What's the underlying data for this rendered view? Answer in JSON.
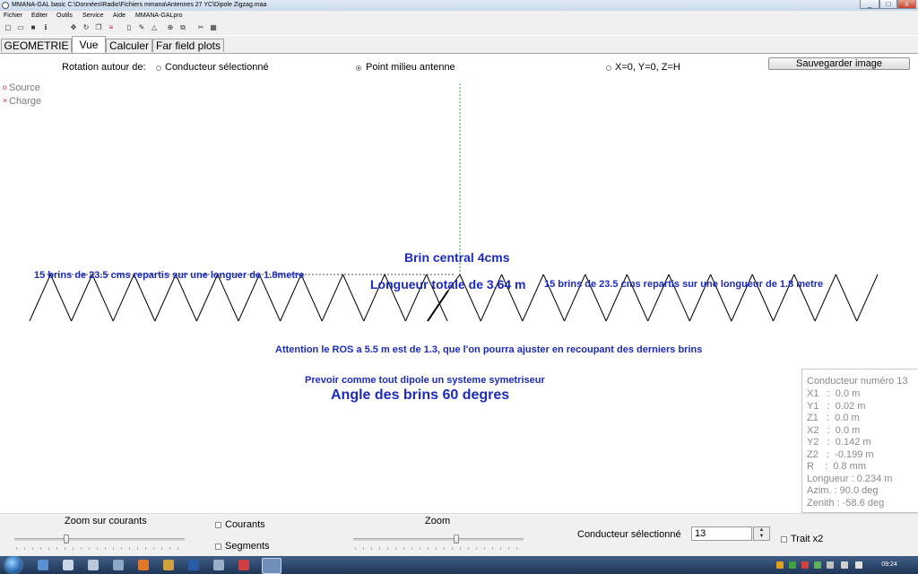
{
  "window": {
    "title": "MMANA-GAL basic C:\\Données\\Radio\\Fichiers mmana\\Antennes 27 YC\\Dipole Zigzag.maa",
    "minimize": "_",
    "maximize": "□",
    "close": "x"
  },
  "menu": [
    "Fichier",
    "Editer",
    "Outils",
    "Service",
    "Aide",
    "MMANA-GALpro"
  ],
  "tabs": [
    "GEOMETRIE",
    "Vue",
    "Calculer",
    "Far field plots"
  ],
  "active_tab": "Vue",
  "view": {
    "rotation_label": "Rotation autour de:",
    "rotation_options": [
      "Conducteur sélectionné",
      "Point milieu antenne",
      "X=0, Y=0, Z=H"
    ],
    "rotation_selected": "Point milieu antenne",
    "save_button": "Sauvegarder image",
    "legend": {
      "source_mark": "o",
      "source": "Source",
      "charge_mark": "×",
      "charge": "Charge"
    },
    "annotations": {
      "central": "Brin central 4cms",
      "left": "15 brins de 23.5 cms repartis sur une longuer de 1.8metre",
      "total": "Longueur totale de 3.64 m",
      "right": "15 brins de 23.5 cms repartis sur une longueur de 1.8 metre",
      "warning": "Attention le ROS a 5.5 m est de 1.3, que l'on pourra ajuster en recoupant des derniers brins",
      "balun": "Prevoir comme tout dipole un systeme symetriseur",
      "angle": "Angle des brins 60 degres"
    },
    "wire_color": "#000000",
    "text_color": "#1c2bbf",
    "axis_color": "#2e9e3e"
  },
  "info": {
    "title": "Conducteur numéro 13",
    "lines": [
      "X1   :  0.0 m",
      "Y1   :  0.02 m",
      "Z1   :  0.0 m",
      "X2   :  0.0 m",
      "Y2   :  0.142 m",
      "Z2   :  -0.199 m",
      "R    :  0.8 mm",
      "Longueur : 0.234 m",
      "Azim. : 90.0 deg",
      "Zenith : -58.6 deg"
    ]
  },
  "bottom": {
    "zoom_courants_label": "Zoom sur courants",
    "courants_label": "Courants",
    "segments_label": "Segments",
    "zoom_label": "Zoom",
    "conducteur_label": "Conducteur sélectionné",
    "conducteur_value": "13",
    "trait_label": "Trait x2"
  },
  "taskbar": {
    "clock": "09:24"
  }
}
